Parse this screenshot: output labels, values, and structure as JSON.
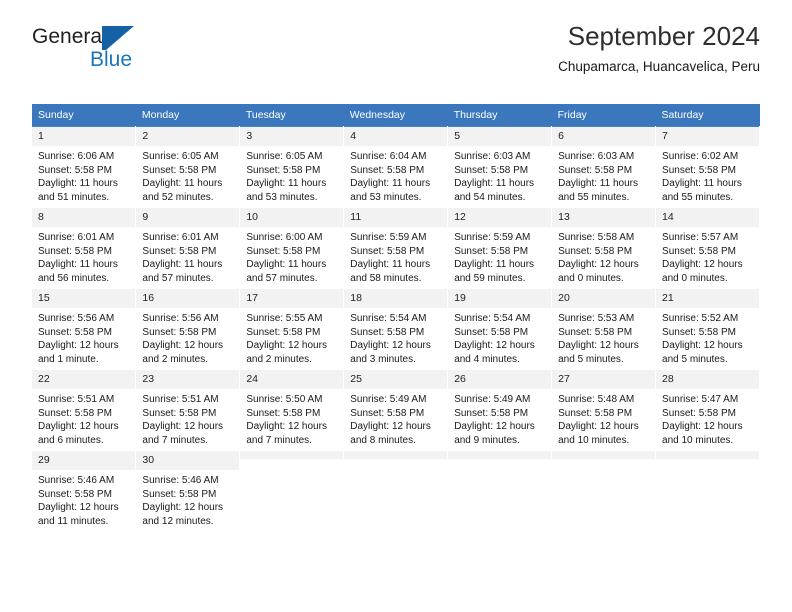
{
  "brand": {
    "name_part1": "General",
    "name_part2": "Blue",
    "mark_icon": "triangle-flag-icon",
    "accent_color": "#1b75bb",
    "mark_color": "#1461a6"
  },
  "header": {
    "title": "September 2024",
    "subtitle": "Chupamarca, Huancavelica, Peru"
  },
  "calendar": {
    "header_bg": "#3b77bc",
    "header_text_color": "#ffffff",
    "daynum_bg": "#f2f2f2",
    "weekday_headers": [
      "Sunday",
      "Monday",
      "Tuesday",
      "Wednesday",
      "Thursday",
      "Friday",
      "Saturday"
    ],
    "weeks": [
      [
        {
          "day": "1",
          "sunrise": "Sunrise: 6:06 AM",
          "sunset": "Sunset: 5:58 PM",
          "daylight_line1": "Daylight: 11 hours",
          "daylight_line2": "and 51 minutes."
        },
        {
          "day": "2",
          "sunrise": "Sunrise: 6:05 AM",
          "sunset": "Sunset: 5:58 PM",
          "daylight_line1": "Daylight: 11 hours",
          "daylight_line2": "and 52 minutes."
        },
        {
          "day": "3",
          "sunrise": "Sunrise: 6:05 AM",
          "sunset": "Sunset: 5:58 PM",
          "daylight_line1": "Daylight: 11 hours",
          "daylight_line2": "and 53 minutes."
        },
        {
          "day": "4",
          "sunrise": "Sunrise: 6:04 AM",
          "sunset": "Sunset: 5:58 PM",
          "daylight_line1": "Daylight: 11 hours",
          "daylight_line2": "and 53 minutes."
        },
        {
          "day": "5",
          "sunrise": "Sunrise: 6:03 AM",
          "sunset": "Sunset: 5:58 PM",
          "daylight_line1": "Daylight: 11 hours",
          "daylight_line2": "and 54 minutes."
        },
        {
          "day": "6",
          "sunrise": "Sunrise: 6:03 AM",
          "sunset": "Sunset: 5:58 PM",
          "daylight_line1": "Daylight: 11 hours",
          "daylight_line2": "and 55 minutes."
        },
        {
          "day": "7",
          "sunrise": "Sunrise: 6:02 AM",
          "sunset": "Sunset: 5:58 PM",
          "daylight_line1": "Daylight: 11 hours",
          "daylight_line2": "and 55 minutes."
        }
      ],
      [
        {
          "day": "8",
          "sunrise": "Sunrise: 6:01 AM",
          "sunset": "Sunset: 5:58 PM",
          "daylight_line1": "Daylight: 11 hours",
          "daylight_line2": "and 56 minutes."
        },
        {
          "day": "9",
          "sunrise": "Sunrise: 6:01 AM",
          "sunset": "Sunset: 5:58 PM",
          "daylight_line1": "Daylight: 11 hours",
          "daylight_line2": "and 57 minutes."
        },
        {
          "day": "10",
          "sunrise": "Sunrise: 6:00 AM",
          "sunset": "Sunset: 5:58 PM",
          "daylight_line1": "Daylight: 11 hours",
          "daylight_line2": "and 57 minutes."
        },
        {
          "day": "11",
          "sunrise": "Sunrise: 5:59 AM",
          "sunset": "Sunset: 5:58 PM",
          "daylight_line1": "Daylight: 11 hours",
          "daylight_line2": "and 58 minutes."
        },
        {
          "day": "12",
          "sunrise": "Sunrise: 5:59 AM",
          "sunset": "Sunset: 5:58 PM",
          "daylight_line1": "Daylight: 11 hours",
          "daylight_line2": "and 59 minutes."
        },
        {
          "day": "13",
          "sunrise": "Sunrise: 5:58 AM",
          "sunset": "Sunset: 5:58 PM",
          "daylight_line1": "Daylight: 12 hours",
          "daylight_line2": "and 0 minutes."
        },
        {
          "day": "14",
          "sunrise": "Sunrise: 5:57 AM",
          "sunset": "Sunset: 5:58 PM",
          "daylight_line1": "Daylight: 12 hours",
          "daylight_line2": "and 0 minutes."
        }
      ],
      [
        {
          "day": "15",
          "sunrise": "Sunrise: 5:56 AM",
          "sunset": "Sunset: 5:58 PM",
          "daylight_line1": "Daylight: 12 hours",
          "daylight_line2": "and 1 minute."
        },
        {
          "day": "16",
          "sunrise": "Sunrise: 5:56 AM",
          "sunset": "Sunset: 5:58 PM",
          "daylight_line1": "Daylight: 12 hours",
          "daylight_line2": "and 2 minutes."
        },
        {
          "day": "17",
          "sunrise": "Sunrise: 5:55 AM",
          "sunset": "Sunset: 5:58 PM",
          "daylight_line1": "Daylight: 12 hours",
          "daylight_line2": "and 2 minutes."
        },
        {
          "day": "18",
          "sunrise": "Sunrise: 5:54 AM",
          "sunset": "Sunset: 5:58 PM",
          "daylight_line1": "Daylight: 12 hours",
          "daylight_line2": "and 3 minutes."
        },
        {
          "day": "19",
          "sunrise": "Sunrise: 5:54 AM",
          "sunset": "Sunset: 5:58 PM",
          "daylight_line1": "Daylight: 12 hours",
          "daylight_line2": "and 4 minutes."
        },
        {
          "day": "20",
          "sunrise": "Sunrise: 5:53 AM",
          "sunset": "Sunset: 5:58 PM",
          "daylight_line1": "Daylight: 12 hours",
          "daylight_line2": "and 5 minutes."
        },
        {
          "day": "21",
          "sunrise": "Sunrise: 5:52 AM",
          "sunset": "Sunset: 5:58 PM",
          "daylight_line1": "Daylight: 12 hours",
          "daylight_line2": "and 5 minutes."
        }
      ],
      [
        {
          "day": "22",
          "sunrise": "Sunrise: 5:51 AM",
          "sunset": "Sunset: 5:58 PM",
          "daylight_line1": "Daylight: 12 hours",
          "daylight_line2": "and 6 minutes."
        },
        {
          "day": "23",
          "sunrise": "Sunrise: 5:51 AM",
          "sunset": "Sunset: 5:58 PM",
          "daylight_line1": "Daylight: 12 hours",
          "daylight_line2": "and 7 minutes."
        },
        {
          "day": "24",
          "sunrise": "Sunrise: 5:50 AM",
          "sunset": "Sunset: 5:58 PM",
          "daylight_line1": "Daylight: 12 hours",
          "daylight_line2": "and 7 minutes."
        },
        {
          "day": "25",
          "sunrise": "Sunrise: 5:49 AM",
          "sunset": "Sunset: 5:58 PM",
          "daylight_line1": "Daylight: 12 hours",
          "daylight_line2": "and 8 minutes."
        },
        {
          "day": "26",
          "sunrise": "Sunrise: 5:49 AM",
          "sunset": "Sunset: 5:58 PM",
          "daylight_line1": "Daylight: 12 hours",
          "daylight_line2": "and 9 minutes."
        },
        {
          "day": "27",
          "sunrise": "Sunrise: 5:48 AM",
          "sunset": "Sunset: 5:58 PM",
          "daylight_line1": "Daylight: 12 hours",
          "daylight_line2": "and 10 minutes."
        },
        {
          "day": "28",
          "sunrise": "Sunrise: 5:47 AM",
          "sunset": "Sunset: 5:58 PM",
          "daylight_line1": "Daylight: 12 hours",
          "daylight_line2": "and 10 minutes."
        }
      ],
      [
        {
          "day": "29",
          "sunrise": "Sunrise: 5:46 AM",
          "sunset": "Sunset: 5:58 PM",
          "daylight_line1": "Daylight: 12 hours",
          "daylight_line2": "and 11 minutes."
        },
        {
          "day": "30",
          "sunrise": "Sunrise: 5:46 AM",
          "sunset": "Sunset: 5:58 PM",
          "daylight_line1": "Daylight: 12 hours",
          "daylight_line2": "and 12 minutes."
        },
        {
          "day": "",
          "sunrise": "",
          "sunset": "",
          "daylight_line1": "",
          "daylight_line2": ""
        },
        {
          "day": "",
          "sunrise": "",
          "sunset": "",
          "daylight_line1": "",
          "daylight_line2": ""
        },
        {
          "day": "",
          "sunrise": "",
          "sunset": "",
          "daylight_line1": "",
          "daylight_line2": ""
        },
        {
          "day": "",
          "sunrise": "",
          "sunset": "",
          "daylight_line1": "",
          "daylight_line2": ""
        },
        {
          "day": "",
          "sunrise": "",
          "sunset": "",
          "daylight_line1": "",
          "daylight_line2": ""
        }
      ]
    ]
  }
}
